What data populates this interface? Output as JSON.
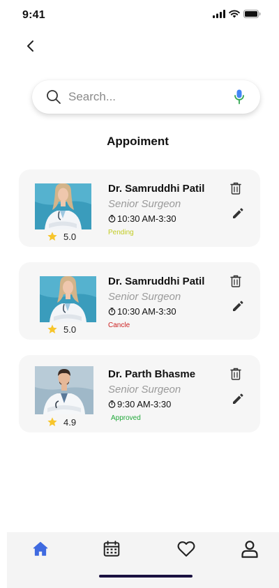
{
  "status_bar": {
    "time": "9:41"
  },
  "search": {
    "placeholder": "Search..."
  },
  "page": {
    "title": "Appoiment"
  },
  "appointments": [
    {
      "name": "Dr. Samruddhi Patil",
      "role": "Senior Surgeon",
      "time": "10:30 AM-3:30",
      "status": "Pending",
      "status_color": "#c2cc22",
      "rating": "5.0"
    },
    {
      "name": "Dr. Samruddhi Patil",
      "role": "Senior Surgeon",
      "time": "10:30 AM-3:30",
      "status": "Cancle",
      "status_color": "#cc1f1f",
      "rating": "5.0"
    },
    {
      "name": "Dr. Parth Bhasme",
      "role": "Senior Surgeon",
      "time": "9:30 AM-3:30",
      "status": "Approved",
      "status_color": "#22a83a",
      "rating": "4.9"
    }
  ],
  "bottom_nav": {
    "items": [
      {
        "icon": "home-icon",
        "active": true
      },
      {
        "icon": "calendar-icon",
        "active": false
      },
      {
        "icon": "heart-icon",
        "active": false
      },
      {
        "icon": "profile-icon",
        "active": false
      }
    ]
  },
  "colors": {
    "accent": "#3f6ae0",
    "star": "#f7c52b",
    "card_bg": "#f6f6f6"
  }
}
